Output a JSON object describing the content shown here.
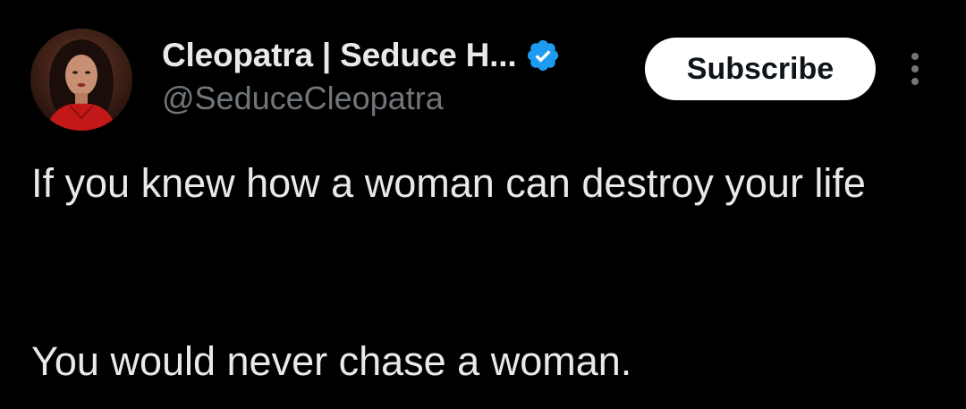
{
  "author": {
    "display_name": "Cleopatra | Seduce H...",
    "handle": "@SeduceCleopatra",
    "verified": true,
    "avatar_icon": "profile-photo-woman"
  },
  "actions": {
    "subscribe_label": "Subscribe",
    "more_icon": "vertical-ellipsis-icon"
  },
  "tweet": {
    "paragraph_1": "If you knew how a woman can destroy your life",
    "paragraph_2": "You would never chase a woman."
  },
  "colors": {
    "background": "#000000",
    "primary_text": "#e7e9ea",
    "secondary_text": "#71767b",
    "verified_blue": "#1d9bf0",
    "button_bg": "#ffffff",
    "button_text": "#0f1419"
  }
}
